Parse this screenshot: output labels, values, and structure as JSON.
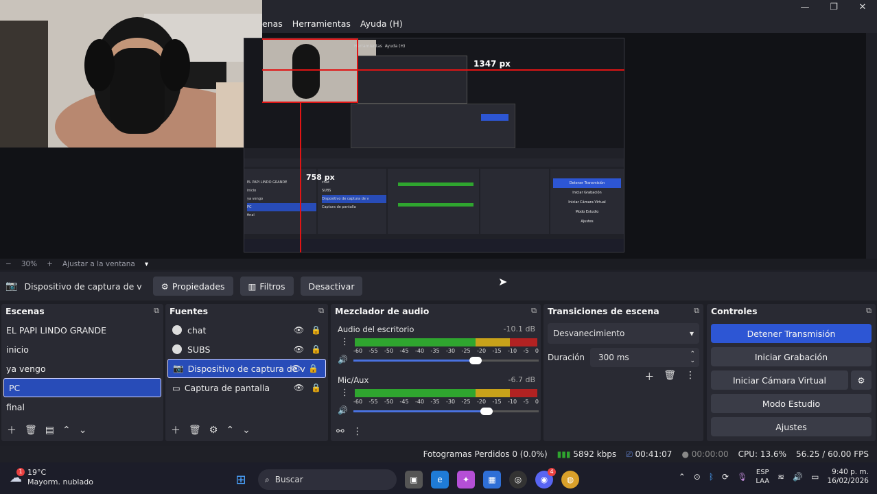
{
  "window": {
    "menu": [
      "enas",
      "Herramientas",
      "Ayuda (H)"
    ],
    "controls": [
      "minimize",
      "maximize",
      "close"
    ]
  },
  "preview": {
    "width_label": "1347 px",
    "height_label": "758 px",
    "nested_menu": [
      "Herramientas",
      "Ayuda (H)"
    ],
    "nested_scenes": [
      "EL PAPI LINDO GRANDE",
      "inicio",
      "ya vengo",
      "PC",
      "final"
    ],
    "nested_sources": [
      "chat",
      "SUBS",
      "Dispositivo de captura de v",
      "Captura de pantalla"
    ],
    "nested_controls": [
      "Detener Transmisión",
      "Iniciar Grabación",
      "Iniciar Cámara Virtual",
      "Modo Estudio",
      "Ajustes"
    ]
  },
  "zoom": {
    "minus": "−",
    "value": "30%",
    "plus": "+",
    "fit_label": "Ajustar a la ventana",
    "dropdown": "▾"
  },
  "source_toolbar": {
    "source_name": "Dispositivo de captura de v",
    "properties": "Propiedades",
    "filters": "Filtros",
    "deactivate": "Desactivar"
  },
  "scenes": {
    "title": "Escenas",
    "items": [
      "EL PAPI LINDO GRANDE",
      "inicio",
      "ya vengo",
      "PC",
      "final"
    ],
    "selected_index": 3
  },
  "sources": {
    "title": "Fuentes",
    "items": [
      "chat",
      "SUBS",
      "Dispositivo de captura de v",
      "Captura de pantalla"
    ],
    "selected_index": 2
  },
  "mixer": {
    "title": "Mezclador de audio",
    "channels": [
      {
        "name": "Audio del escritorio",
        "db": "-10.1 dB",
        "volume": 0.66,
        "level": 0.8
      },
      {
        "name": "Mic/Aux",
        "db": "-6.7 dB",
        "volume": 0.72,
        "level": 0.75
      }
    ],
    "scale": [
      "-60",
      "-55",
      "-50",
      "-45",
      "-40",
      "-35",
      "-30",
      "-25",
      "-20",
      "-15",
      "-10",
      "-5",
      "0"
    ]
  },
  "transitions": {
    "title": "Transiciones de escena",
    "selected": "Desvanecimiento",
    "duration_label": "Duración",
    "duration_value": "300 ms"
  },
  "controls": {
    "title": "Controles",
    "stop_stream": "Detener Transmisión",
    "start_recording": "Iniciar Grabación",
    "start_virtual_cam": "Iniciar Cámara Virtual",
    "studio_mode": "Modo Estudio",
    "settings": "Ajustes"
  },
  "status": {
    "dropped_frames": "Fotogramas Perdidos 0 (0.0%)",
    "bitrate": "5892 kbps",
    "stream_time": "00:41:07",
    "rec_time": "00:00:00",
    "cpu": "CPU: 13.6%",
    "fps": "56.25 / 60.00 FPS"
  },
  "taskbar": {
    "weather_temp": "19°C",
    "weather_desc": "Mayorm. nublado",
    "weather_badge": "1",
    "search_placeholder": "Buscar",
    "lang_top": "ESP",
    "lang_bottom": "LAA",
    "time": "9:40 p. m.",
    "date": "16/02/2026",
    "discord_badge": "4"
  },
  "colors": {
    "accent_selected": "#284cb8",
    "stop_button": "#2d56d4",
    "guide_red": "#e01414",
    "meter_green": "#2fa52f",
    "meter_yellow": "#c8a21a",
    "meter_red": "#b22222"
  }
}
